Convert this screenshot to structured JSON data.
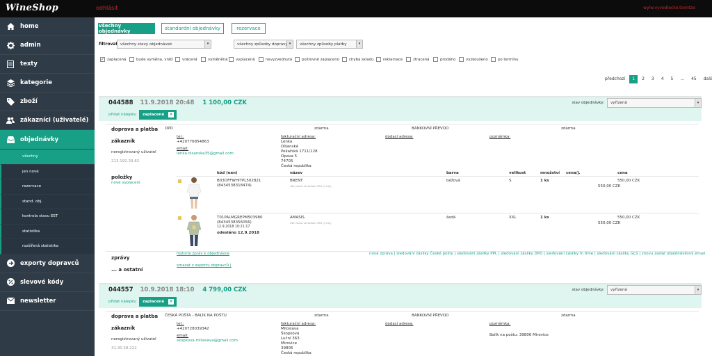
{
  "header": {
    "logo": "WineShop",
    "logout": "odhlásit",
    "warning": "wylw.vyvedlecke.tonntze"
  },
  "sidebar": {
    "items": [
      {
        "label": "home",
        "icon": "home-icon"
      },
      {
        "label": "admin",
        "icon": "gear-icon"
      },
      {
        "label": "texty",
        "icon": "document-icon"
      },
      {
        "label": "kategorie",
        "icon": "layers-icon"
      },
      {
        "label": "zboží",
        "icon": "tag-icon"
      },
      {
        "label": "zákazníci (uživatelé)",
        "icon": "users-icon"
      },
      {
        "label": "objednávky",
        "icon": "inbox-icon"
      }
    ],
    "subitems": [
      "všechny",
      "jen nové",
      "rezervace",
      "stand. obj.",
      "kontrola stavu EET",
      "statistika",
      "rozšířená statistika"
    ],
    "bottom_items": [
      {
        "label": "exporty dopravců",
        "icon": "arrow-right-icon"
      },
      {
        "label": "slevové kódy",
        "icon": "percent-icon"
      },
      {
        "label": "newsletter",
        "icon": "mail-icon"
      }
    ]
  },
  "tabs": [
    "všechny objednávky",
    "standardní objednávky",
    "rezervace"
  ],
  "filter": {
    "label": "filtrovat:",
    "selects": [
      "všechny stavy objednávek",
      "všechny způsoby dopravy",
      "všechny způsoby platby"
    ],
    "checkboxes": [
      {
        "label": "zaplacená",
        "checked": true
      },
      {
        "label": "bude vyměna, vrátí",
        "checked": false
      },
      {
        "label": "vrácená",
        "checked": false
      },
      {
        "label": "vyměněná",
        "checked": false
      },
      {
        "label": "vyplacená",
        "checked": false
      },
      {
        "label": "nevyzvednutá",
        "checked": false
      },
      {
        "label": "poštovné zaplaceno",
        "checked": false
      },
      {
        "label": "chyba skladu",
        "checked": false
      },
      {
        "label": "reklamace",
        "checked": false
      },
      {
        "label": "ztracená",
        "checked": false
      },
      {
        "label": "prodáno",
        "checked": false
      },
      {
        "label": "vyzkoušeno",
        "checked": false
      },
      {
        "label": "po termínu",
        "checked": false
      }
    ]
  },
  "pagination": {
    "prev": "předchozí",
    "pages": [
      "1",
      "2",
      "3",
      "4",
      "5",
      "...",
      "45"
    ],
    "current": "1",
    "next": "další"
  },
  "labels": {
    "add_sticker": "přidat nálepku",
    "status": "stav objednávky:",
    "shipping": "doprava a platba",
    "customer": "zákazník",
    "items": "položky",
    "new_billing": "nové vyplacení",
    "messages": "zprávy",
    "other": "... a ostatní",
    "unregistered": "neregistrovaný uživatel",
    "phone": "tel.:",
    "email": "email:",
    "billing": "fakturační adresa:",
    "delivery": "dodací adresa:",
    "note": "poznámka:",
    "free": "zdarma",
    "cols": [
      "kód (ean)",
      "název",
      "barva",
      "velikost",
      "množství",
      "cena/j.",
      "cena"
    ],
    "history": "historie zpráv k objednávce",
    "export": "smazat z exportu dopravců |",
    "msg_links": "nová zpráva | sledování zásilky České pošty | sledování zásilky PPL | sledování zásilky DPD | sledování zásilky In time | sledování zásilky GLS | znovu zaslat objednávkový email"
  },
  "orders": [
    {
      "id": "044588",
      "date": "11.9.2018 20:48",
      "price": "1 100,00 CZK",
      "badge": "zaplacená",
      "status": "vyřízená",
      "carrier": "DPD",
      "carrier_price": "zdarma",
      "payment": "BANKOVNÍ PŘEVOD",
      "payment_price": "zdarma",
      "ip": "213.192.39.82",
      "phone": "+420776854863",
      "email": "lenka.olsanska35@gmail.com",
      "billing": [
        "Lenka",
        "Olšanská",
        "Pekařská 1711/128",
        "Opava 5",
        "74705",
        "Česká republika"
      ],
      "items": [
        {
          "code": "B03OFFWHITPL502821",
          "ean": "(8434538318474)",
          "name": "BRENT",
          "stock": "vše (sono ve skladu 990 [1 ks])",
          "color": "béžová",
          "size": "S",
          "qty": "1 ks",
          "unit": "550,00 CZK",
          "total": "550,00 CZK"
        },
        {
          "code": "T01PALMGREPM503980",
          "ean": "(8434538356056)",
          "name": "AMASIS",
          "stock": "vše (sono ve skladu 990 [1 ks])",
          "color": "šedá",
          "size": "XXL",
          "qty": "1 ks",
          "unit": "550,00 CZK",
          "total": "550,00 CZK",
          "date": "12.9.2018 10:21:17",
          "sent": "odesláno 12.9.2018"
        }
      ]
    },
    {
      "id": "044557",
      "date": "10.9.2018 18:10",
      "price": "4 799,00 CZK",
      "badge": "zaplacená",
      "status": "vyřízená",
      "carrier": "ČESKÁ POŠTA - BALÍK NA POŠTU",
      "carrier_price": "zdarma",
      "payment": "BANKOVNÍ PŘEVOD",
      "payment_price": "zdarma",
      "ip": "31.30.58.222",
      "phone": "+420728039342",
      "email": "skopkova.miloslava@gmail.com",
      "billing": [
        "Miloslava",
        "Škopková",
        "Luční 363",
        "Mirovice",
        "39806",
        "Česká republika"
      ],
      "note": "Balík na poštu: 39806 Mirovice"
    }
  ]
}
